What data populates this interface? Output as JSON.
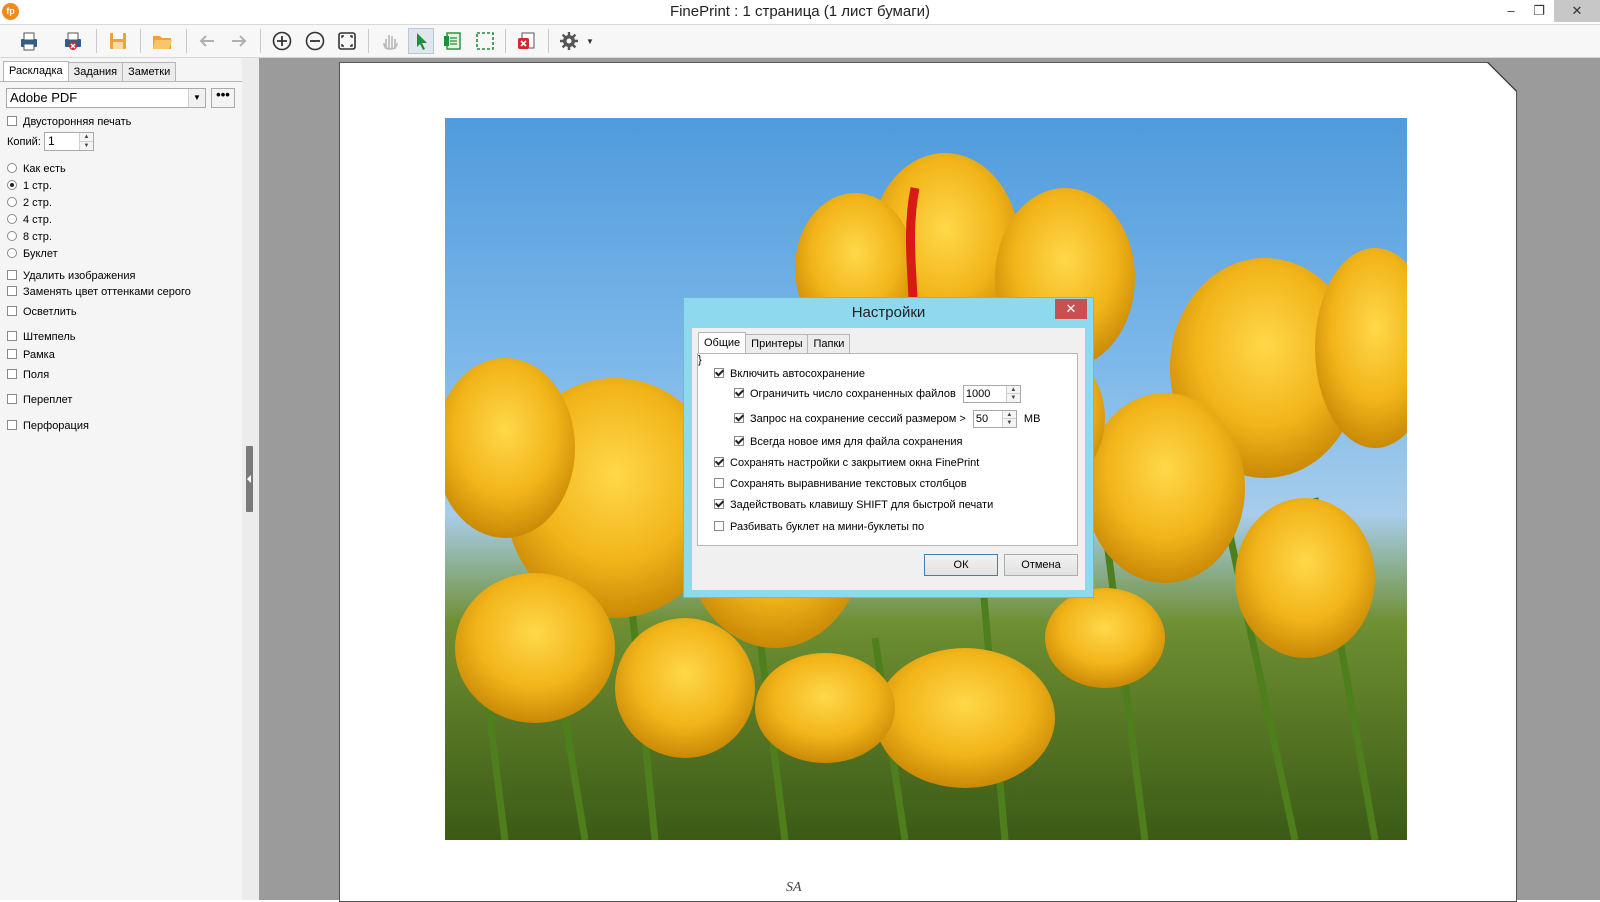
{
  "window": {
    "title": "FinePrint : 1 страница (1 лист бумаги)",
    "logo": "fp",
    "minimize_icon": "minimize-icon",
    "restore_icon": "restore-icon",
    "close_icon": "close-icon"
  },
  "toolbar": {
    "buttons": [
      "print-icon",
      "print-delete-icon",
      "save-icon",
      "open-folder-icon",
      "back-arrow-icon",
      "forward-arrow-icon",
      "zoom-in-icon",
      "zoom-out-icon",
      "fit-page-icon",
      "hand-icon",
      "pointer-icon",
      "green-page-icon",
      "select-rect-icon",
      "delete-job-icon",
      "gear-icon"
    ]
  },
  "left_panel": {
    "tabs": [
      "Раскладка",
      "Задания",
      "Заметки"
    ],
    "active_tab": "Раскладка",
    "printer": "Adobe PDF",
    "more_label": "•••",
    "duplex_label": "Двусторонняя печать",
    "copies_label": "Копий:",
    "copies_value": "1",
    "layout_options": [
      {
        "label": "Как есть",
        "selected": false
      },
      {
        "label": "1 стр.",
        "selected": true
      },
      {
        "label": "2 стр.",
        "selected": false
      },
      {
        "label": "4 стр.",
        "selected": false
      },
      {
        "label": "8 стр.",
        "selected": false
      },
      {
        "label": "Буклет",
        "selected": false
      }
    ],
    "checkboxes_a": [
      "Удалить изображения",
      "Заменять цвет оттенками серого",
      "Осветлить"
    ],
    "checkboxes_b": [
      "Штемпель",
      "Рамка",
      "Поля"
    ],
    "binding_label": "Переплет",
    "perforation_label": "Перфорация"
  },
  "preview": {
    "footer_mark": "SA"
  },
  "dialog": {
    "title": "Настройки",
    "close_label": "✕",
    "tabs": [
      "Общие",
      "Принтеры",
      "Папки"
    ],
    "active_tab": "Общие",
    "options": {
      "autosave": {
        "label": "Включить автосохранение",
        "checked": true
      },
      "limit_files": {
        "label": "Ограничить число сохраненных файлов",
        "checked": true,
        "value": "1000"
      },
      "session_prompt": {
        "label": "Запрос на сохранение сессий размером >",
        "checked": true,
        "value": "50",
        "unit": "МВ"
      },
      "always_new_name": {
        "label": "Всегда новое имя для файла сохранения",
        "checked": true
      },
      "save_on_close": {
        "label": "Сохранять настройки с закрытием окна FinePrint",
        "checked": true
      },
      "save_alignment": {
        "label": "Сохранять выравнивание текстовых столбцов",
        "checked": false
      },
      "shift_key": {
        "label": "Задействовать клавишу SHIFT для быстрой печати",
        "checked": true
      },
      "split_booklet": {
        "label": "Разбивать буклет на мини-буклеты по",
        "checked": false
      }
    },
    "ok_label": "ОК",
    "cancel_label": "Отмена"
  }
}
